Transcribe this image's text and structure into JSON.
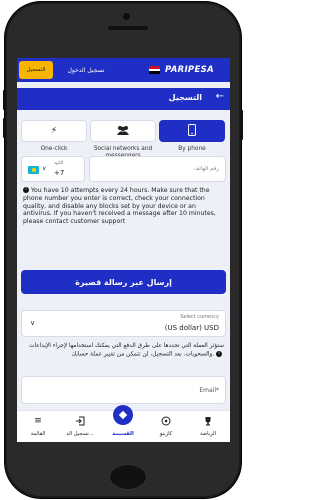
{
  "header": {
    "register_button": "التسجيل",
    "login_button": "تسجيل الدخول",
    "logo": "PARIPESA"
  },
  "page": {
    "title": "التسجيل"
  },
  "tabs": [
    {
      "label": "One-click",
      "icon": "lightning-icon"
    },
    {
      "label": "Social networks and messengers",
      "icon": "people-icon"
    },
    {
      "label": "By phone",
      "icon": "phone-icon",
      "active": true
    }
  ],
  "phone": {
    "code_label": "الكود",
    "code": "+7",
    "placeholder": "رقم الهاتف"
  },
  "notice": "You have 10 attempts every 24 hours. Make sure that the phone number you enter is correct, check your connection quality, and disable any blocks set by your device or an antivirus. If you haven't received a message after 10 minutes, please contact customer support",
  "sms_button": "إرسال عبر رسالة قصيرة",
  "currency": {
    "label": "Select currency",
    "value": "(US dollar)  USD",
    "note": "ستؤثر العملة التي تحددها على طرق الدفع التي يمكنك استخدامها لإجراء الإيداعات والسحوبات. بعد التسجيل، لن تتمكن من تغيير عملة حسابك."
  },
  "email": {
    "placeholder": "Email*"
  },
  "bottom_nav": [
    {
      "label": "الرياضة",
      "icon": "trophy-icon"
    },
    {
      "label": "كازينو",
      "icon": "casino-icon"
    },
    {
      "label": "القسيمة",
      "icon": "coupon-icon",
      "active": true
    },
    {
      "label": "تسجيل الد...",
      "icon": "login-icon"
    },
    {
      "label": "القائمة",
      "icon": "menu-icon"
    }
  ],
  "colors": {
    "primary": "#1f2ec4",
    "accent": "#f7b500"
  }
}
